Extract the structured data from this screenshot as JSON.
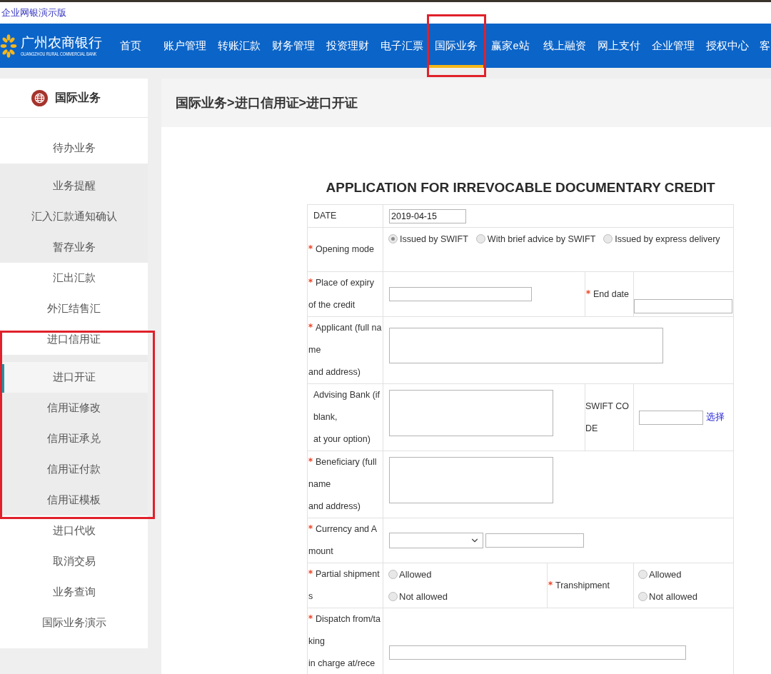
{
  "top_bar": {
    "title": "企业网银演示版"
  },
  "nav": {
    "logo": {
      "name": "广州农商银行",
      "subtitle": "GUANGZHOU RURAL COMMERCIAL BANK"
    },
    "items": [
      {
        "label": "首页",
        "selected": false,
        "highlighted": false
      },
      {
        "label": "账户管理",
        "selected": false,
        "highlighted": false
      },
      {
        "label": "转账汇款",
        "selected": false,
        "highlighted": false
      },
      {
        "label": "财务管理",
        "selected": false,
        "highlighted": false
      },
      {
        "label": "投资理财",
        "selected": false,
        "highlighted": false
      },
      {
        "label": "电子汇票",
        "selected": false,
        "highlighted": false
      },
      {
        "label": "国际业务",
        "selected": true,
        "highlighted": true
      },
      {
        "label": "赢家e站",
        "selected": false,
        "highlighted": false
      },
      {
        "label": "线上融资",
        "selected": false,
        "highlighted": false
      },
      {
        "label": "网上支付",
        "selected": false,
        "highlighted": false
      },
      {
        "label": "企业管理",
        "selected": false,
        "highlighted": false
      },
      {
        "label": "授权中心",
        "selected": false,
        "highlighted": false
      },
      {
        "label": "客",
        "selected": false,
        "highlighted": false
      }
    ]
  },
  "sidebar": {
    "title": "国际业务",
    "items": [
      {
        "label": "待办业务",
        "selected": false,
        "highlighted": false,
        "expanded": true,
        "children": [
          {
            "label": "业务提醒",
            "selected": false
          },
          {
            "label": "汇入汇款通知确认",
            "selected": false
          },
          {
            "label": "暂存业务",
            "selected": false
          }
        ]
      },
      {
        "label": "汇出汇款",
        "selected": false,
        "highlighted": false
      },
      {
        "label": "外汇结售汇",
        "selected": false,
        "highlighted": false
      },
      {
        "label": "进口信用证",
        "selected": false,
        "highlighted": true,
        "expanded": true,
        "children": [
          {
            "label": "进口开证",
            "selected": true
          },
          {
            "label": "信用证修改",
            "selected": false
          },
          {
            "label": "信用证承兑",
            "selected": false
          },
          {
            "label": "信用证付款",
            "selected": false
          },
          {
            "label": "信用证模板",
            "selected": false
          }
        ]
      },
      {
        "label": "进口代收",
        "selected": false,
        "highlighted": false
      },
      {
        "label": "取消交易",
        "selected": false,
        "highlighted": false
      },
      {
        "label": "业务查询",
        "selected": false,
        "highlighted": false
      },
      {
        "label": "国际业务演示",
        "selected": false,
        "highlighted": false
      }
    ]
  },
  "breadcrumb": "国际业务>进口信用证>进口开证",
  "form": {
    "title": "APPLICATION FOR IRREVOCABLE DOCUMENTARY CREDIT",
    "rows": [
      {
        "label": [
          "DATE"
        ],
        "required": false,
        "fields": [
          {
            "kind": "date",
            "value": "2019-04-15"
          }
        ]
      },
      {
        "label": [
          "Opening mode"
        ],
        "required": true,
        "fields": [
          {
            "kind": "radios",
            "options": [
              {
                "label": "Issued by SWIFT",
                "selected": true
              },
              {
                "label": "With brief advice by SWIFT",
                "selected": false
              },
              {
                "label": "Issued by express delivery",
                "selected": false
              }
            ]
          }
        ]
      },
      {
        "label": [
          "Place of expiry",
          "of the credit"
        ],
        "required": true,
        "fields": [
          {
            "kind": "text"
          }
        ],
        "aside": {
          "label": [
            "End date"
          ],
          "required": true,
          "fields": [
            {
              "kind": "text"
            }
          ]
        }
      },
      {
        "label": [
          "Applicant (full name",
          "and address)"
        ],
        "required": true,
        "fields": [
          {
            "kind": "textarea"
          }
        ]
      },
      {
        "label": [
          "Advising Bank (if blank,",
          "at your option)"
        ],
        "required": false,
        "fields": [
          {
            "kind": "textarea"
          }
        ],
        "aside": {
          "label": [
            "SWIFT CODE"
          ],
          "required": false,
          "fields": [
            {
              "kind": "text"
            },
            {
              "kind": "link",
              "label": "选择"
            }
          ]
        }
      },
      {
        "label": [
          "Beneficiary (full name",
          "and address)"
        ],
        "required": true,
        "fields": [
          {
            "kind": "textarea"
          }
        ]
      },
      {
        "label": [
          "Currency and Amount"
        ],
        "required": true,
        "fields": [
          {
            "kind": "select"
          },
          {
            "kind": "text"
          }
        ]
      },
      {
        "label": [
          "Partial shipments"
        ],
        "required": true,
        "fields": [
          {
            "kind": "radiostack",
            "options": [
              {
                "label": "Allowed",
                "selected": false
              },
              {
                "label": "Not allowed",
                "selected": false
              }
            ]
          }
        ],
        "aside": {
          "label": [
            "Transhipment"
          ],
          "required": true,
          "fields": [
            {
              "kind": "radiostack",
              "options": [
                {
                  "label": "Allowed",
                  "selected": false
                },
                {
                  "label": "Not allowed",
                  "selected": false
                }
              ]
            }
          ]
        }
      },
      {
        "label": [
          "Dispatch from/taking",
          "in charge at/rece"
        ],
        "required": true,
        "fields": [
          {
            "kind": "text"
          }
        ]
      }
    ]
  }
}
